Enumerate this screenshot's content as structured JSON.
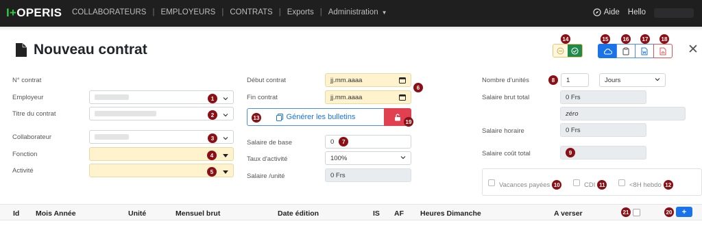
{
  "navbar": {
    "brand_prefix": "I+",
    "brand_suffix": "OPERIS",
    "items": [
      "COLLABORATEURS",
      "EMPLOYEURS",
      "CONTRATS",
      "Exports",
      "Administration"
    ],
    "aide_label": "Aide",
    "hello_label": "Hello"
  },
  "page": {
    "title": "Nouveau contrat"
  },
  "labels": {
    "numero_contrat": "N° contrat",
    "employeur": "Employeur",
    "titre_contrat": "Titre du contrat",
    "collaborateur": "Collaborateur",
    "fonction": "Fonction",
    "activite": "Activité",
    "debut_contrat": "Début contrat",
    "fin_contrat": "Fin contrat",
    "salaire_base": "Salaire de base",
    "taux_activite": "Taux d'activité",
    "salaire_unite": "Salaire /unité",
    "nombre_unites": "Nombre d'unités",
    "salaire_brut_total": "Salaire brut total",
    "salaire_horaire": "Salaire horaire",
    "salaire_cout_total": "Salaire coût total"
  },
  "fields": {
    "debut_contrat_placeholder": "jj.mm.aaaa",
    "fin_contrat_placeholder": "jj.mm.aaaa",
    "salaire_base_value": "0",
    "taux_activite_value": "100%",
    "salaire_unite_value": "0 Frs",
    "nombre_unites_value": "1",
    "unite_type_value": "Jours",
    "salaire_brut_total_value": "0 Frs",
    "salaire_en_lettres_value": "zéro",
    "salaire_horaire_value": "0 Frs"
  },
  "buttons": {
    "generer_bulletins": "Générer les bulletins",
    "add": "+"
  },
  "checkboxes": {
    "vacances_payees": "Vacances payées",
    "cdi": "CDI",
    "moins_8h": "<8H hebdo"
  },
  "table": {
    "headers": [
      "Id",
      "Mois Année",
      "Unité",
      "Mensuel brut",
      "Date édition",
      "IS",
      "AF",
      "Heures Dimanche",
      "A verser"
    ]
  },
  "badges": [
    "1",
    "2",
    "3",
    "4",
    "5",
    "6",
    "7",
    "8",
    "9",
    "10",
    "11",
    "12",
    "13",
    "14",
    "15",
    "16",
    "17",
    "18",
    "19",
    "20",
    "21"
  ],
  "colors": {
    "navbar_bg": "#1f1f20",
    "brand_accent": "#2ecc40",
    "badge_bg": "#8b0f14",
    "primary": "#1a73e8",
    "danger": "#e04050",
    "highlight_field": "#fff3cd"
  }
}
